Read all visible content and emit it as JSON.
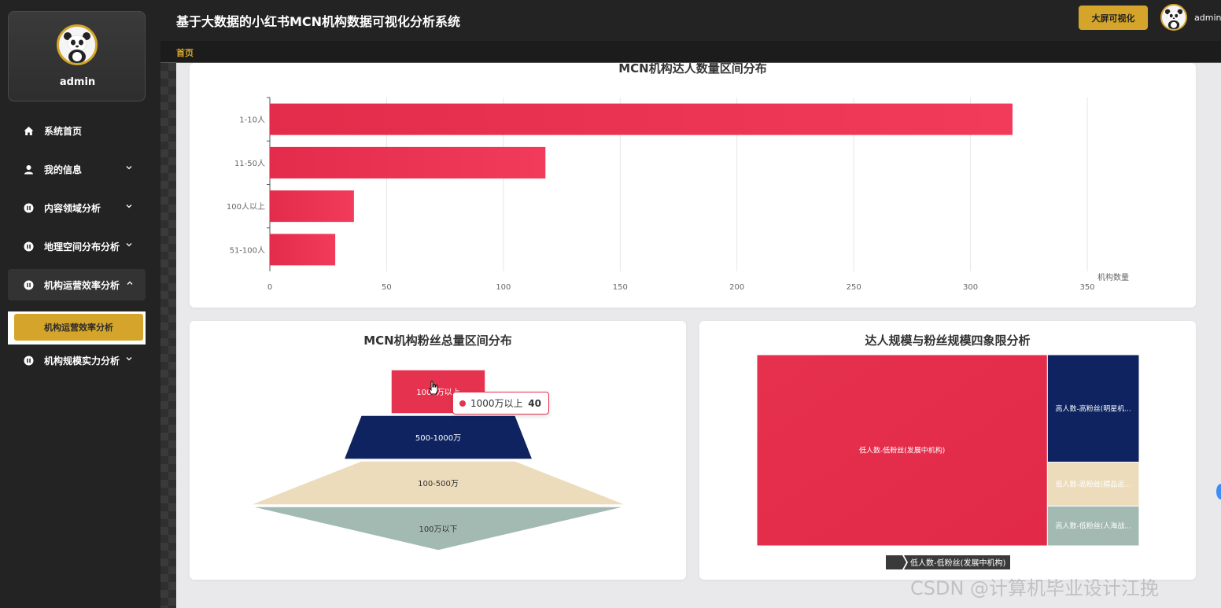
{
  "sidebar": {
    "profile_name": "admin",
    "menu": [
      {
        "label": "系统首页",
        "icon": "home-icon",
        "has_children": false
      },
      {
        "label": "我的信息",
        "icon": "user-icon",
        "has_children": true
      },
      {
        "label": "内容领域分析",
        "icon": "pause-circle-icon",
        "has_children": true
      },
      {
        "label": "地理空间分布分析",
        "icon": "pause-circle-icon",
        "has_children": true
      },
      {
        "label": "机构运营效率分析",
        "icon": "pause-circle-icon",
        "has_children": true,
        "expanded": true
      },
      {
        "label": "机构规模实力分析",
        "icon": "pause-circle-icon",
        "has_children": true
      }
    ],
    "active_submenu": "机构运营效率分析"
  },
  "header": {
    "title": "基于大数据的小红书MCN机构数据可视化分析系统",
    "bigscreen_label": "大屏可视化",
    "user_name": "admin"
  },
  "breadcrumb": "首页",
  "watermark": "CSDN @计算机毕业设计江挽",
  "colors": {
    "accent": "#d4a52a",
    "red": "#e5334f",
    "navy": "#0e2360",
    "beige": "#ecdcbc",
    "sage": "#a3bab2"
  },
  "chart_data": [
    {
      "type": "bar",
      "orientation": "horizontal",
      "title": "MCN机构达人数量区间分布",
      "categories": [
        "1-10人",
        "11-50人",
        "100人以上",
        "51-100人"
      ],
      "values": [
        318,
        118,
        36,
        28
      ],
      "xlabel": "机构数量",
      "xlim": [
        0,
        350
      ],
      "xticks": [
        0,
        50,
        100,
        150,
        200,
        250,
        300,
        350
      ],
      "grid": true
    },
    {
      "type": "funnel",
      "title": "MCN机构粉丝总量区间分布",
      "categories": [
        "1000万以上",
        "500-1000万",
        "100-500万",
        "100万以下"
      ],
      "values": [
        40,
        70,
        160,
        160
      ],
      "tooltip": {
        "label": "1000万以上",
        "value": "40"
      }
    },
    {
      "type": "treemap",
      "title": "达人规模与粉丝规模四象限分析",
      "items": [
        {
          "label": "低人数-低粉丝(发展中机构)",
          "value": 76
        },
        {
          "label": "高人数-高粉丝(明星机...",
          "value": 13.5
        },
        {
          "label": "低人数-高粉丝(精品运...",
          "value": 5.5
        },
        {
          "label": "高人数-低粉丝(人海战...",
          "value": 5
        }
      ],
      "breadcrumb": "低人数-低粉丝(发展中机构)"
    }
  ]
}
